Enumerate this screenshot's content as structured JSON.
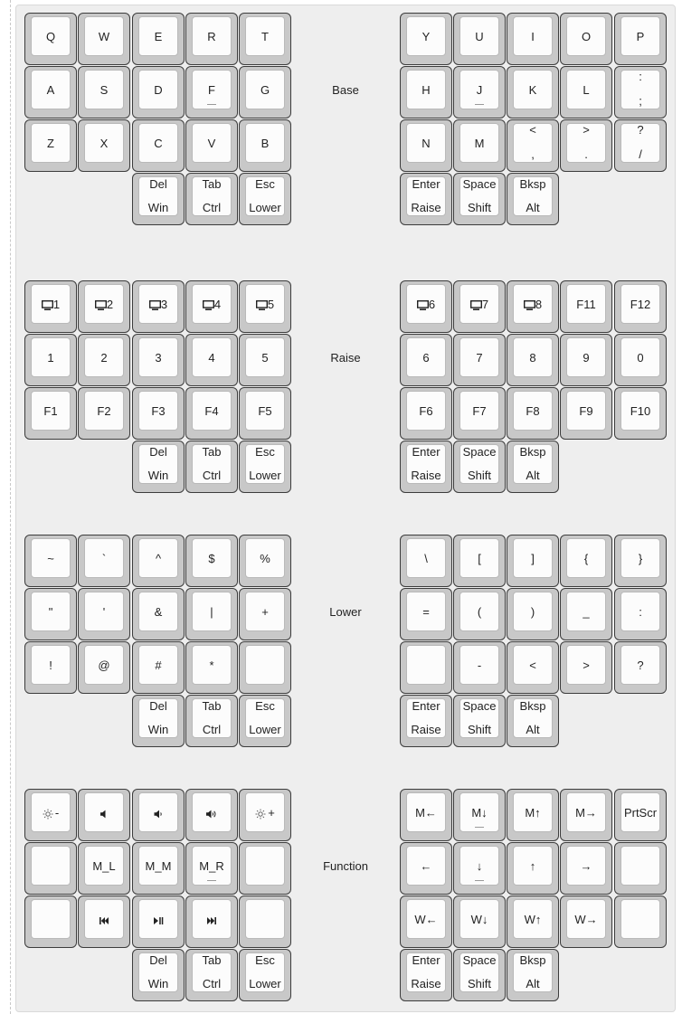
{
  "layers": [
    {
      "name": "Base",
      "left": [
        [
          {
            "center": "Q"
          },
          {
            "center": "W"
          },
          {
            "center": "E"
          },
          {
            "center": "R"
          },
          {
            "center": "T"
          }
        ],
        [
          {
            "center": "A"
          },
          {
            "center": "S"
          },
          {
            "center": "D"
          },
          {
            "center": "F",
            "homing": true
          },
          {
            "center": "G"
          }
        ],
        [
          {
            "center": "Z"
          },
          {
            "center": "X"
          },
          {
            "center": "C"
          },
          {
            "center": "V"
          },
          {
            "center": "B"
          }
        ]
      ],
      "right": [
        [
          {
            "center": "Y"
          },
          {
            "center": "U"
          },
          {
            "center": "I"
          },
          {
            "center": "O"
          },
          {
            "center": "P"
          }
        ],
        [
          {
            "center": "H"
          },
          {
            "center": "J",
            "homing": true
          },
          {
            "center": "K"
          },
          {
            "center": "L"
          },
          {
            "top": ":",
            "bottom": ";"
          }
        ],
        [
          {
            "center": "N"
          },
          {
            "center": "M"
          },
          {
            "top": "<",
            "bottom": ","
          },
          {
            "top": ">",
            "bottom": "."
          },
          {
            "top": "?",
            "bottom": "/"
          }
        ]
      ],
      "thumbs_left": [
        {
          "tap": "Del",
          "hold": "Win"
        },
        {
          "tap": "Tab",
          "hold": "Ctrl"
        },
        {
          "tap": "Esc",
          "hold": "Lower"
        }
      ],
      "thumbs_right": [
        {
          "tap": "Enter",
          "hold": "Raise"
        },
        {
          "tap": "Space",
          "hold": "Shift"
        },
        {
          "tap": "Bksp",
          "hold": "Alt"
        }
      ]
    },
    {
      "name": "Raise",
      "left": [
        [
          {
            "center": "1",
            "icon": "desktop"
          },
          {
            "center": "2",
            "icon": "desktop"
          },
          {
            "center": "3",
            "icon": "desktop"
          },
          {
            "center": "4",
            "icon": "desktop"
          },
          {
            "center": "5",
            "icon": "desktop"
          }
        ],
        [
          {
            "center": "1"
          },
          {
            "center": "2"
          },
          {
            "center": "3"
          },
          {
            "center": "4"
          },
          {
            "center": "5"
          }
        ],
        [
          {
            "center": "F1"
          },
          {
            "center": "F2"
          },
          {
            "center": "F3"
          },
          {
            "center": "F4"
          },
          {
            "center": "F5"
          }
        ]
      ],
      "right": [
        [
          {
            "center": "6",
            "icon": "desktop"
          },
          {
            "center": "7",
            "icon": "desktop"
          },
          {
            "center": "8",
            "icon": "desktop"
          },
          {
            "center": "F11"
          },
          {
            "center": "F12"
          }
        ],
        [
          {
            "center": "6"
          },
          {
            "center": "7"
          },
          {
            "center": "8"
          },
          {
            "center": "9"
          },
          {
            "center": "0"
          }
        ],
        [
          {
            "center": "F6"
          },
          {
            "center": "F7"
          },
          {
            "center": "F8"
          },
          {
            "center": "F9"
          },
          {
            "center": "F10"
          }
        ]
      ],
      "thumbs_left": [
        {
          "tap": "Del",
          "hold": "Win"
        },
        {
          "tap": "Tab",
          "hold": "Ctrl"
        },
        {
          "tap": "Esc",
          "hold": "Lower"
        }
      ],
      "thumbs_right": [
        {
          "tap": "Enter",
          "hold": "Raise"
        },
        {
          "tap": "Space",
          "hold": "Shift"
        },
        {
          "tap": "Bksp",
          "hold": "Alt"
        }
      ]
    },
    {
      "name": "Lower",
      "left": [
        [
          {
            "center": "~"
          },
          {
            "center": "`"
          },
          {
            "center": "^"
          },
          {
            "center": "$"
          },
          {
            "center": "%"
          }
        ],
        [
          {
            "center": "\""
          },
          {
            "center": "'"
          },
          {
            "center": "&"
          },
          {
            "center": "|"
          },
          {
            "center": "+"
          }
        ],
        [
          {
            "center": "!"
          },
          {
            "center": "@"
          },
          {
            "center": "#"
          },
          {
            "center": "*"
          },
          {
            "center": ""
          }
        ]
      ],
      "right": [
        [
          {
            "center": "\\"
          },
          {
            "center": "["
          },
          {
            "center": "]"
          },
          {
            "center": "{"
          },
          {
            "center": "}"
          }
        ],
        [
          {
            "center": "="
          },
          {
            "center": "("
          },
          {
            "center": ")"
          },
          {
            "center": "_"
          },
          {
            "center": ":"
          }
        ],
        [
          {
            "center": ""
          },
          {
            "center": "-"
          },
          {
            "center": "<"
          },
          {
            "center": ">"
          },
          {
            "center": "?"
          }
        ]
      ],
      "thumbs_left": [
        {
          "tap": "Del",
          "hold": "Win"
        },
        {
          "tap": "Tab",
          "hold": "Ctrl"
        },
        {
          "tap": "Esc",
          "hold": "Lower"
        }
      ],
      "thumbs_right": [
        {
          "tap": "Enter",
          "hold": "Raise"
        },
        {
          "tap": "Space",
          "hold": "Shift"
        },
        {
          "tap": "Bksp",
          "hold": "Alt"
        }
      ]
    },
    {
      "name": "Function",
      "left": [
        [
          {
            "center": "-",
            "icon": "brightness"
          },
          {
            "center": "",
            "icon": "vol-mute"
          },
          {
            "center": "",
            "icon": "vol-down"
          },
          {
            "center": "",
            "icon": "vol-up"
          },
          {
            "center": "+",
            "icon": "brightness"
          }
        ],
        [
          {
            "center": ""
          },
          {
            "center": "M_L"
          },
          {
            "center": "M_M"
          },
          {
            "center": "M_R",
            "homing": true
          },
          {
            "center": ""
          }
        ],
        [
          {
            "center": ""
          },
          {
            "center": "",
            "icon": "prev-track"
          },
          {
            "center": "",
            "icon": "play-pause"
          },
          {
            "center": "",
            "icon": "next-track"
          },
          {
            "center": ""
          }
        ]
      ],
      "right": [
        [
          {
            "center": "M←"
          },
          {
            "center": "M↓",
            "homing": true
          },
          {
            "center": "M↑"
          },
          {
            "center": "M→"
          },
          {
            "center": "PrtScr"
          }
        ],
        [
          {
            "center": "←"
          },
          {
            "center": "↓",
            "homing": true
          },
          {
            "center": "↑"
          },
          {
            "center": "→"
          },
          {
            "center": ""
          }
        ],
        [
          {
            "center": "W←"
          },
          {
            "center": "W↓"
          },
          {
            "center": "W↑"
          },
          {
            "center": "W→"
          },
          {
            "center": ""
          }
        ]
      ],
      "thumbs_left": [
        {
          "tap": "Del",
          "hold": "Win"
        },
        {
          "tap": "Tab",
          "hold": "Ctrl"
        },
        {
          "tap": "Esc",
          "hold": "Lower"
        }
      ],
      "thumbs_right": [
        {
          "tap": "Enter",
          "hold": "Raise"
        },
        {
          "tap": "Space",
          "hold": "Shift"
        },
        {
          "tap": "Bksp",
          "hold": "Alt"
        }
      ]
    }
  ]
}
